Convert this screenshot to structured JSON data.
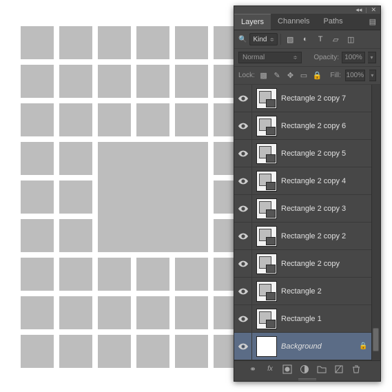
{
  "titlebar": {
    "collapse_glyph": "◂◂",
    "close_glyph": "✕"
  },
  "tabs": [
    "Layers",
    "Channels",
    "Paths"
  ],
  "active_tab": 0,
  "filter": {
    "search_glyph": "🔍",
    "kind_label": "Kind",
    "kind_arrow": "≑",
    "icons": [
      "image-icon",
      "adjust-icon",
      "type-icon",
      "shape-icon",
      "smart-icon"
    ]
  },
  "blend": {
    "mode": "Normal",
    "opacity_label": "Opacity:",
    "opacity_value": "100%"
  },
  "lock": {
    "label": "Lock:",
    "icons": [
      "pixels-icon",
      "brush-icon",
      "move-icon",
      "artboard-icon",
      "all-icon"
    ],
    "fill_label": "Fill:",
    "fill_value": "100%"
  },
  "layers": [
    {
      "name": "Rectangle 2 copy 7",
      "type": "vector",
      "locked": false,
      "selected": false
    },
    {
      "name": "Rectangle 2 copy 6",
      "type": "vector",
      "locked": false,
      "selected": false
    },
    {
      "name": "Rectangle 2 copy 5",
      "type": "vector",
      "locked": false,
      "selected": false
    },
    {
      "name": "Rectangle 2 copy 4",
      "type": "vector",
      "locked": false,
      "selected": false
    },
    {
      "name": "Rectangle 2 copy 3",
      "type": "vector",
      "locked": false,
      "selected": false
    },
    {
      "name": "Rectangle 2 copy 2",
      "type": "vector",
      "locked": false,
      "selected": false
    },
    {
      "name": "Rectangle 2 copy",
      "type": "vector",
      "locked": false,
      "selected": false
    },
    {
      "name": "Rectangle 2",
      "type": "vector",
      "locked": false,
      "selected": false
    },
    {
      "name": "Rectangle 1",
      "type": "vector",
      "locked": false,
      "selected": false
    },
    {
      "name": "Background",
      "type": "bg",
      "locked": true,
      "selected": true
    }
  ],
  "footer_icons": [
    "link-icon",
    "fx-icon",
    "mask-icon",
    "adjustment-icon",
    "group-icon",
    "new-icon",
    "trash-icon"
  ]
}
